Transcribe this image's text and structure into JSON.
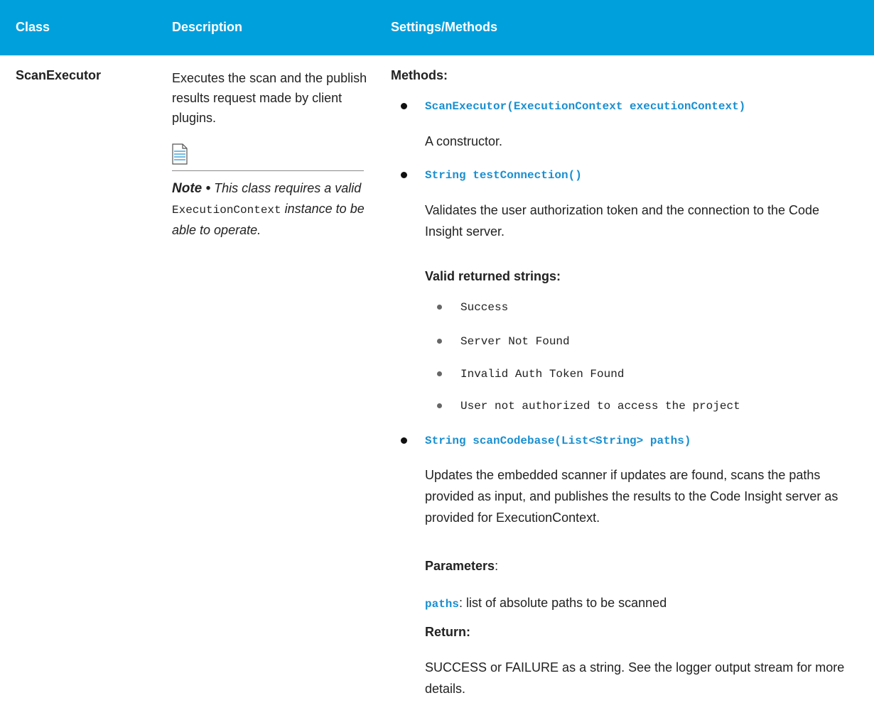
{
  "header": {
    "class_label": "Class",
    "description_label": "Description",
    "settings_label": "Settings/Methods"
  },
  "row": {
    "class_name": "ScanExecutor",
    "description": "Executes the scan and the publish results request made by client plugins.",
    "note": {
      "label": "Note •",
      "text_before": "This class requires a valid",
      "code": "ExecutionContext",
      "text_after": "instance to be able to operate."
    },
    "methods_heading": "Methods:",
    "methods": [
      {
        "signature": "ScanExecutor(ExecutionContext executionContext)",
        "description": "A constructor."
      },
      {
        "signature": "String testConnection()",
        "description": "Validates the user authorization token and the connection to the Code Insight server.",
        "returns_heading": "Valid returned strings:",
        "returns": [
          "Success",
          "Server Not Found",
          "Invalid Auth Token Found",
          "User not authorized to access the project"
        ]
      },
      {
        "signature": "String scanCodebase(List<String> paths)",
        "description": "Updates the embedded scanner if updates are found, scans the paths provided as input, and publishes the results to the Code Insight server as provided for ExecutionContext.",
        "parameters_heading": "Parameters",
        "parameter_name": "paths",
        "parameter_desc": ": list of absolute paths to be scanned",
        "return_heading": "Return:",
        "return_text": "SUCCESS or FAILURE as a string. See the logger output stream for more details."
      }
    ]
  },
  "colors": {
    "header_bg": "#00a0dd",
    "link_blue": "#1a8fd0"
  }
}
